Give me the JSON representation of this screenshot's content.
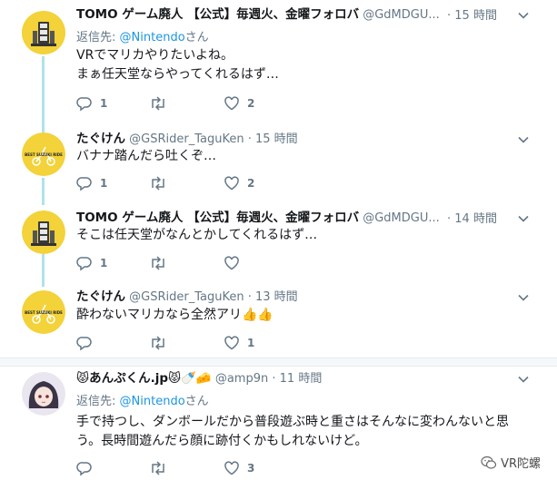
{
  "tweets": [
    {
      "name": "TOMO ゲーム廃人 【公式】毎週火、金曜フォロバ",
      "handle": "@GdMDGU...",
      "sep": "·",
      "time": "15 時間",
      "reply_prefix": "返信先:",
      "reply_to": "@Nintendo",
      "reply_suffix": "さん",
      "lines": [
        "VRでマリカやりたいよね。",
        "まぁ任天堂ならやってくれるはず…"
      ],
      "reply_count": "1",
      "retweet_count": "",
      "like_count": "2"
    },
    {
      "name": "たぐけん",
      "handle": "@GSRider_TaguKen",
      "sep": "·",
      "time": "15 時間",
      "lines": [
        "バナナ踏んだら吐くぞ…"
      ],
      "reply_count": "1",
      "retweet_count": "",
      "like_count": "2"
    },
    {
      "name": "TOMO ゲーム廃人 【公式】毎週火、金曜フォロバ",
      "handle": "@GdMDGU...",
      "sep": "·",
      "time": "14 時間",
      "lines": [
        "そこは任天堂がなんとかしてくれるはず…"
      ],
      "reply_count": "1",
      "retweet_count": "",
      "like_count": ""
    },
    {
      "name": "たぐけん",
      "handle": "@GSRider_TaguKen",
      "sep": "·",
      "time": "13 時間",
      "lines": [
        "酔わないマリカなら全然アリ👍👍"
      ],
      "reply_count": "",
      "retweet_count": "",
      "like_count": "1"
    },
    {
      "name": "😾あんぷくん.jp😾🍼🧀",
      "handle": "@amp9n",
      "sep": "·",
      "time": "11 時間",
      "reply_prefix": "返信先:",
      "reply_to": "@Nintendo",
      "reply_suffix": "さん",
      "lines": [
        "手で持つし、ダンボールだから普段遊ぶ時と重さはそんなに変わんないと思",
        "う。長時間遊んだら顔に跡付くかもしれないけど。"
      ],
      "reply_count": "",
      "retweet_count": "",
      "like_count": "3"
    }
  ],
  "avatar_badge_text": "BEST SUZUKI RIDE",
  "watermark": "VR陀螺",
  "colors": {
    "thread_line": "#aee3ea",
    "link": "#1b95e0",
    "secondary": "#657786",
    "avatar_yellow": "#f3d23a"
  }
}
